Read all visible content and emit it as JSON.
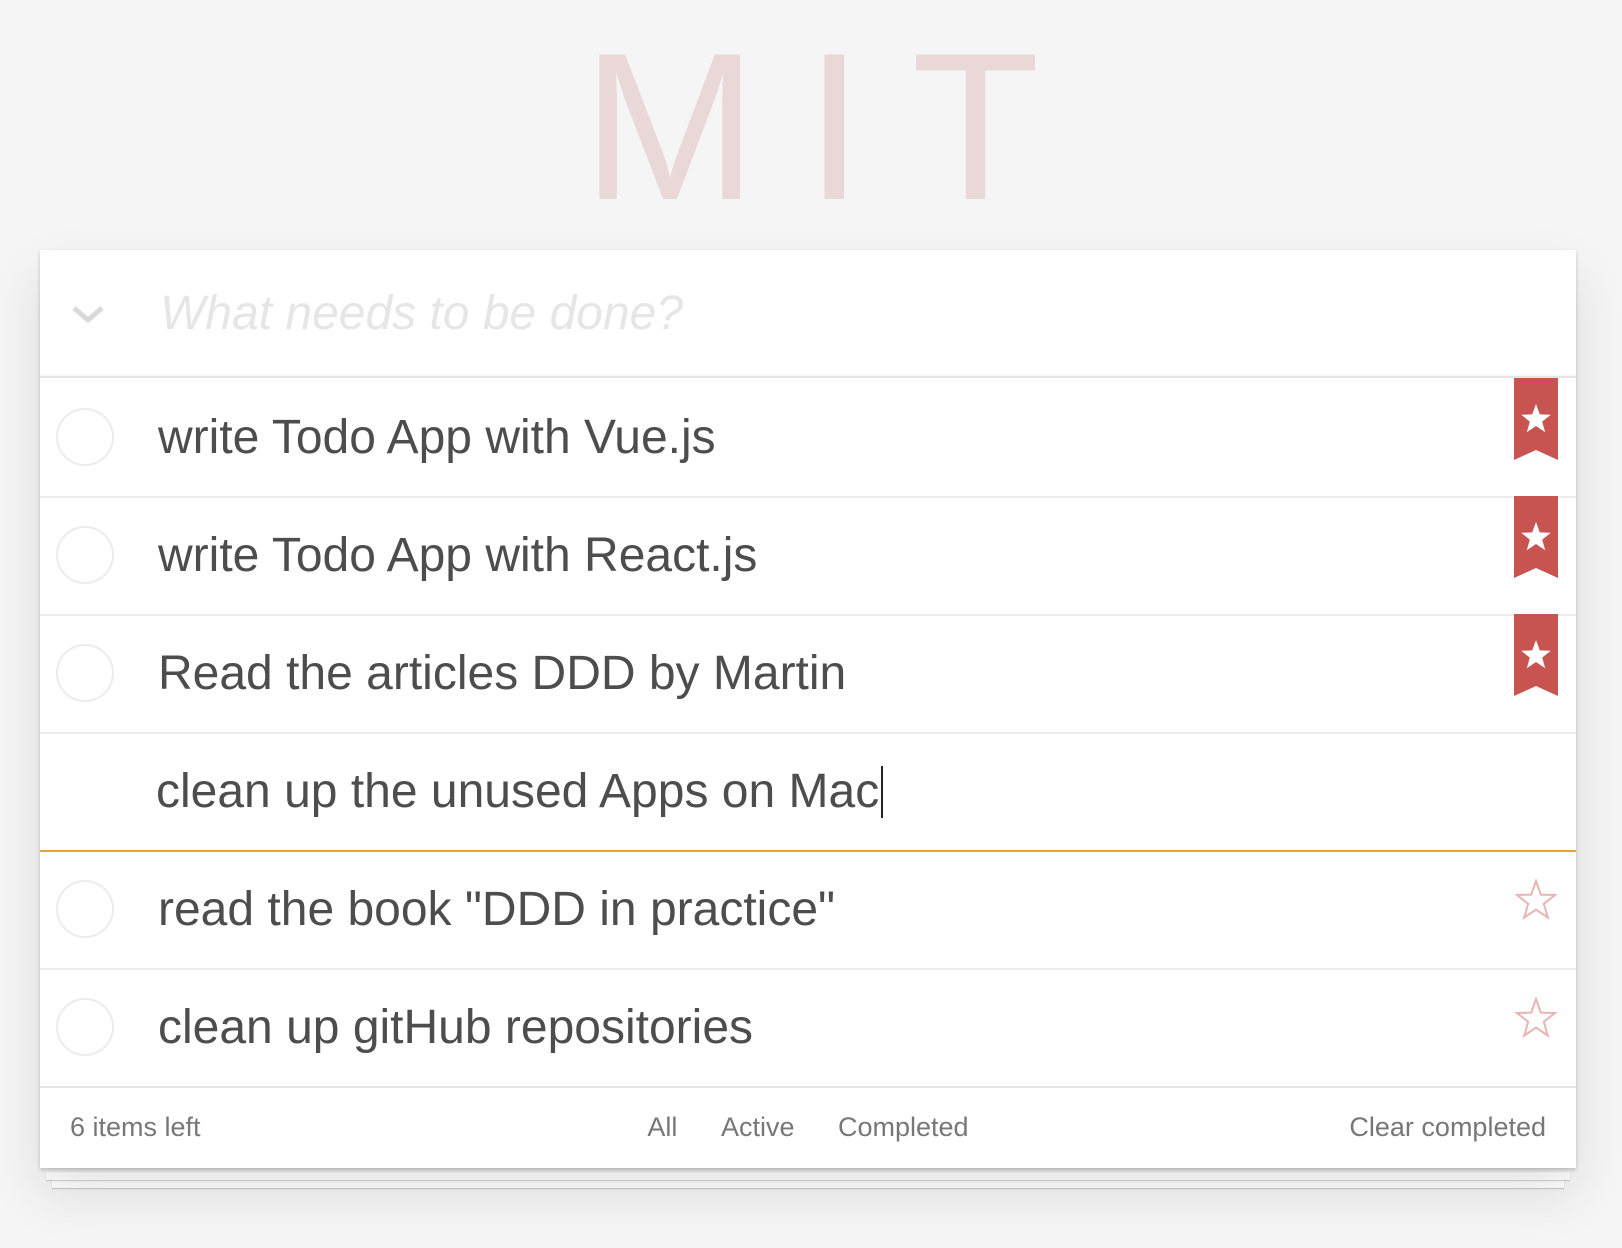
{
  "header": {
    "title": "MIT"
  },
  "new_todo": {
    "placeholder": "What needs to be done?",
    "value": ""
  },
  "icons": {
    "toggle_all": "chevron-down-icon",
    "bookmark": "bookmark-star-icon",
    "star": "star-outline-icon",
    "bookmark_color": "#c75450",
    "star_outline_color": "#e8b4b4"
  },
  "todos": [
    {
      "label": "write Todo App with Vue.js",
      "starred": true,
      "completed": false
    },
    {
      "label": "write Todo App with React.js",
      "starred": true,
      "completed": false
    },
    {
      "label": "Read the articles DDD by Martin",
      "starred": true,
      "completed": false
    },
    {
      "label": "clean up the unused Apps on Mac",
      "editing": true,
      "starred": false,
      "completed": false
    },
    {
      "label": "read the book \"DDD in practice\"",
      "starred": false,
      "completed": false
    },
    {
      "label": "clean up gitHub repositories",
      "starred": false,
      "completed": false
    }
  ],
  "footer": {
    "count_label": "6 items left",
    "filters": [
      "All",
      "Active",
      "Completed"
    ],
    "clear_label": "Clear completed"
  },
  "colors": {
    "accent": "#e0a43b",
    "title": "#ead7d7",
    "bookmark": "#c75450"
  }
}
